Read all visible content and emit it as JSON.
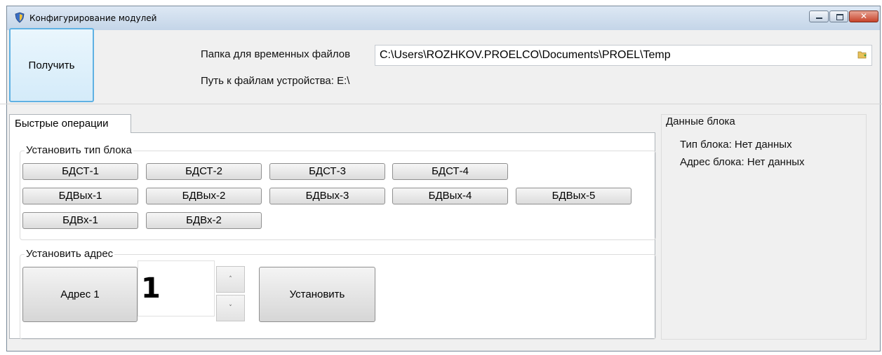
{
  "window": {
    "title": "Конфигурирование модулей"
  },
  "top": {
    "get_button": "Получить",
    "temp_folder_label": "Папка для временных файлов",
    "temp_folder_value": "C:\\Users\\ROZHKOV.PROELCO\\Documents\\PROEL\\Temp",
    "device_path_label": "Путь к файлам устройства: E:\\"
  },
  "tabs": [
    {
      "label": "Быстрые операции"
    }
  ],
  "block_type": {
    "title": "Установить тип блока",
    "buttons": [
      "БДСТ-1",
      "БДСТ-2",
      "БДСТ-3",
      "БДСТ-4",
      "БДВых-1",
      "БДВых-2",
      "БДВых-3",
      "БДВых-4",
      "БДВых-5",
      "БДВх-1",
      "БДВх-2"
    ]
  },
  "address": {
    "title": "Установить адрес",
    "address_button": "Адрес 1",
    "value": "1",
    "set_button": "Установить",
    "up_glyph": "˄",
    "down_glyph": "˅"
  },
  "block_data": {
    "title": "Данные блока",
    "type_line": "Тип блока: Нет данных",
    "address_line": "Адрес блока: Нет данных"
  },
  "colors": {
    "accent_border": "#5fb1e3",
    "close_button": "#c7432a"
  },
  "icons": [
    "app-shield-icon",
    "minimize-icon",
    "maximize-icon",
    "close-icon",
    "folder-icon"
  ]
}
